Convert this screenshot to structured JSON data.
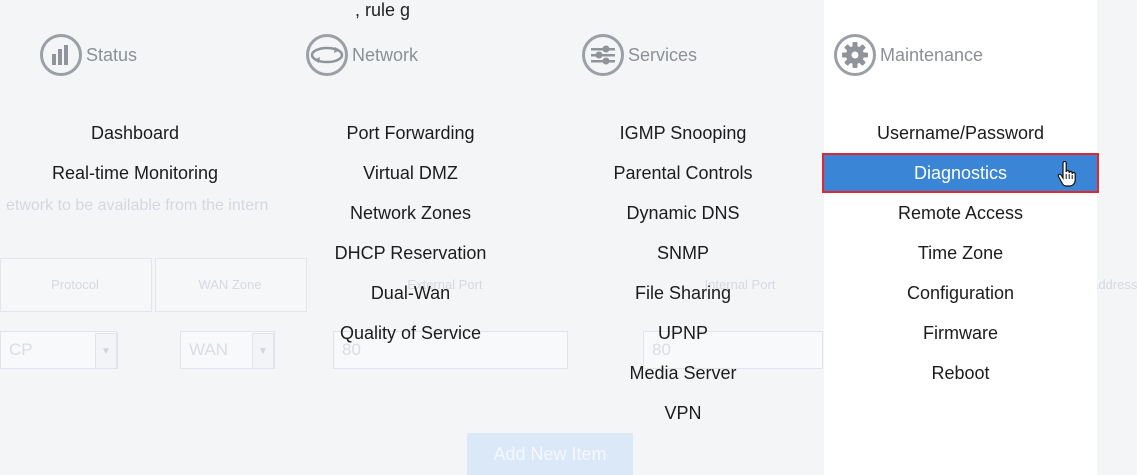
{
  "background": {
    "top_text": ", rule g",
    "hint": "etwork to be available from the intern",
    "table_headers": [
      "Protocol",
      "WAN Zone",
      "External Port",
      "Internal Port",
      "Address"
    ],
    "protocol_value": "CP",
    "wan_value": "WAN",
    "external_port_value": "80",
    "internal_port_value": "80",
    "add_button": "Add New Item"
  },
  "menu": {
    "status": {
      "title": "Status",
      "icon": "bar-chart-icon",
      "items": [
        "Dashboard",
        "Real-time Monitoring"
      ]
    },
    "network": {
      "title": "Network",
      "icon": "network-icon",
      "items": [
        "Port Forwarding",
        "Virtual DMZ",
        "Network Zones",
        "DHCP Reservation",
        "Dual-Wan",
        "Quality of Service"
      ]
    },
    "services": {
      "title": "Services",
      "icon": "services-icon",
      "items": [
        "IGMP Snooping",
        "Parental Controls",
        "Dynamic DNS",
        "SNMP",
        "File Sharing",
        "UPNP",
        "Media Server",
        "VPN"
      ]
    },
    "maintenance": {
      "title": "Maintenance",
      "icon": "gear-icon",
      "items": [
        "Username/Password",
        "Diagnostics",
        "Remote Access",
        "Time Zone",
        "Configuration",
        "Firmware",
        "Reboot"
      ],
      "active": "Diagnostics"
    }
  },
  "colors": {
    "active_bg": "#3a85d6",
    "active_border": "#e0282e",
    "icon_gray": "#9aa0a6"
  }
}
